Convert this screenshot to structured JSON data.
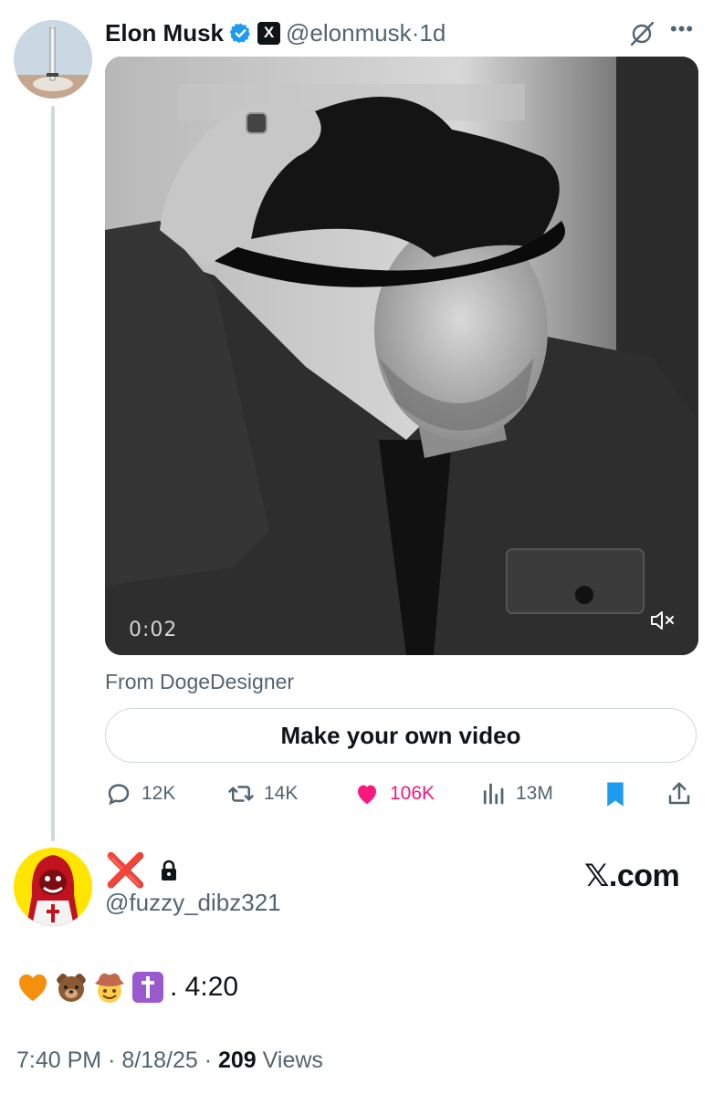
{
  "tweet": {
    "author_name": "Elon Musk",
    "handle": "@elonmusk",
    "separator": "·",
    "age": "1d",
    "x_badge": "X",
    "media": {
      "duration": "0:02",
      "muted": true
    },
    "from_label": "From DogeDesigner",
    "cta_button": "Make your own video",
    "stats": {
      "replies": "12K",
      "reposts": "14K",
      "likes": "106K",
      "views": "13M"
    },
    "icons": [
      "verified-badge-icon",
      "x-affiliate-icon",
      "grok-icon",
      "more-icon",
      "reply-icon",
      "repost-icon",
      "heart-icon",
      "views-icon",
      "bookmark-icon",
      "share-icon",
      "mute-icon"
    ]
  },
  "reply": {
    "display_name_glyph": "❌",
    "handle": "@fuzzy_dibz321",
    "watermark": "𝕏.com",
    "text_suffix": ". 4:20",
    "emojis": [
      "orange-heart",
      "bear",
      "cowboy-face",
      "latin-cross"
    ],
    "footer": {
      "time": "7:40 PM",
      "date": "8/18/25",
      "views_count": "209",
      "views_label": "Views",
      "sep": "·"
    }
  },
  "colors": {
    "verified_blue": "#1d9bf0",
    "like_pink": "#f91880",
    "bookmark_blue": "#1d9bf0",
    "secondary_text": "#536471",
    "primary_text": "#0f1419",
    "red_x": "#e0241b"
  }
}
